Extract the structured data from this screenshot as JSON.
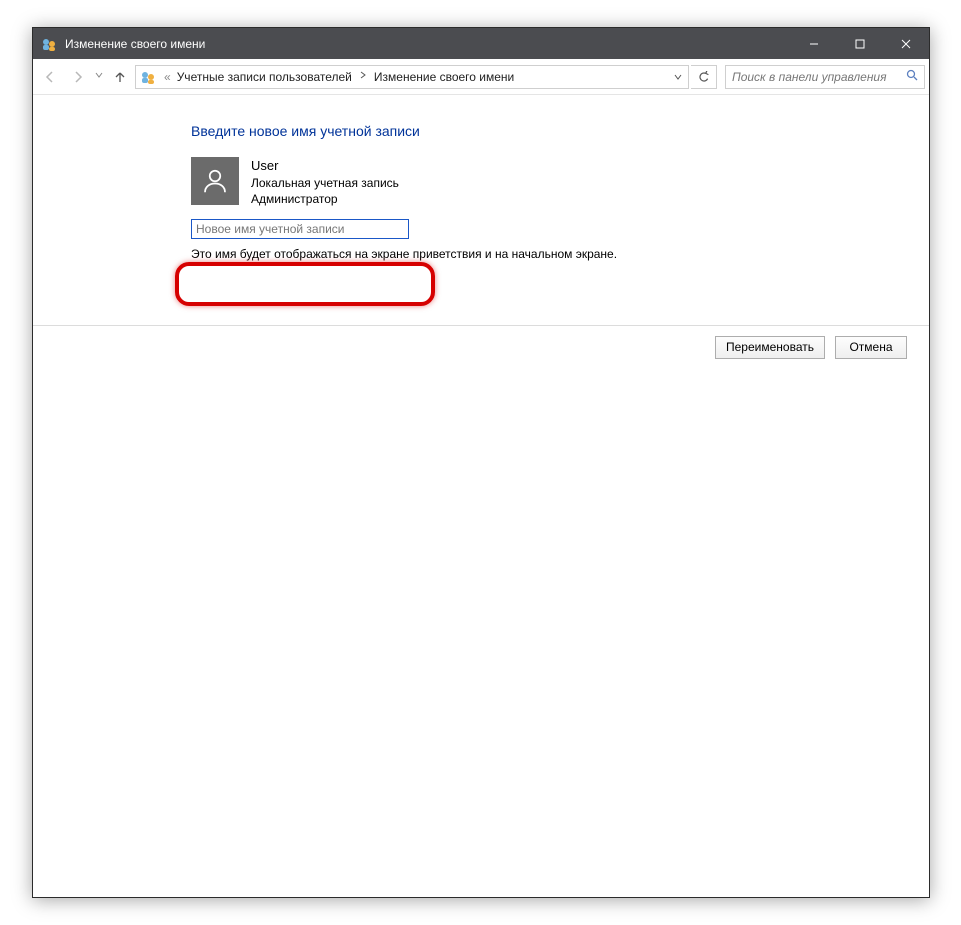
{
  "window": {
    "title": "Изменение своего имени"
  },
  "breadcrumb": {
    "prefix": "«",
    "item1": "Учетные записи пользователей",
    "item2": "Изменение своего имени"
  },
  "search": {
    "placeholder": "Поиск в панели управления"
  },
  "page": {
    "heading": "Введите новое имя учетной записи",
    "hint": "Это имя будет отображаться на экране приветствия и на начальном экране."
  },
  "user": {
    "name": "User",
    "type": "Локальная учетная запись",
    "role": "Администратор"
  },
  "input": {
    "placeholder": "Новое имя учетной записи"
  },
  "buttons": {
    "rename": "Переименовать",
    "cancel": "Отмена"
  }
}
